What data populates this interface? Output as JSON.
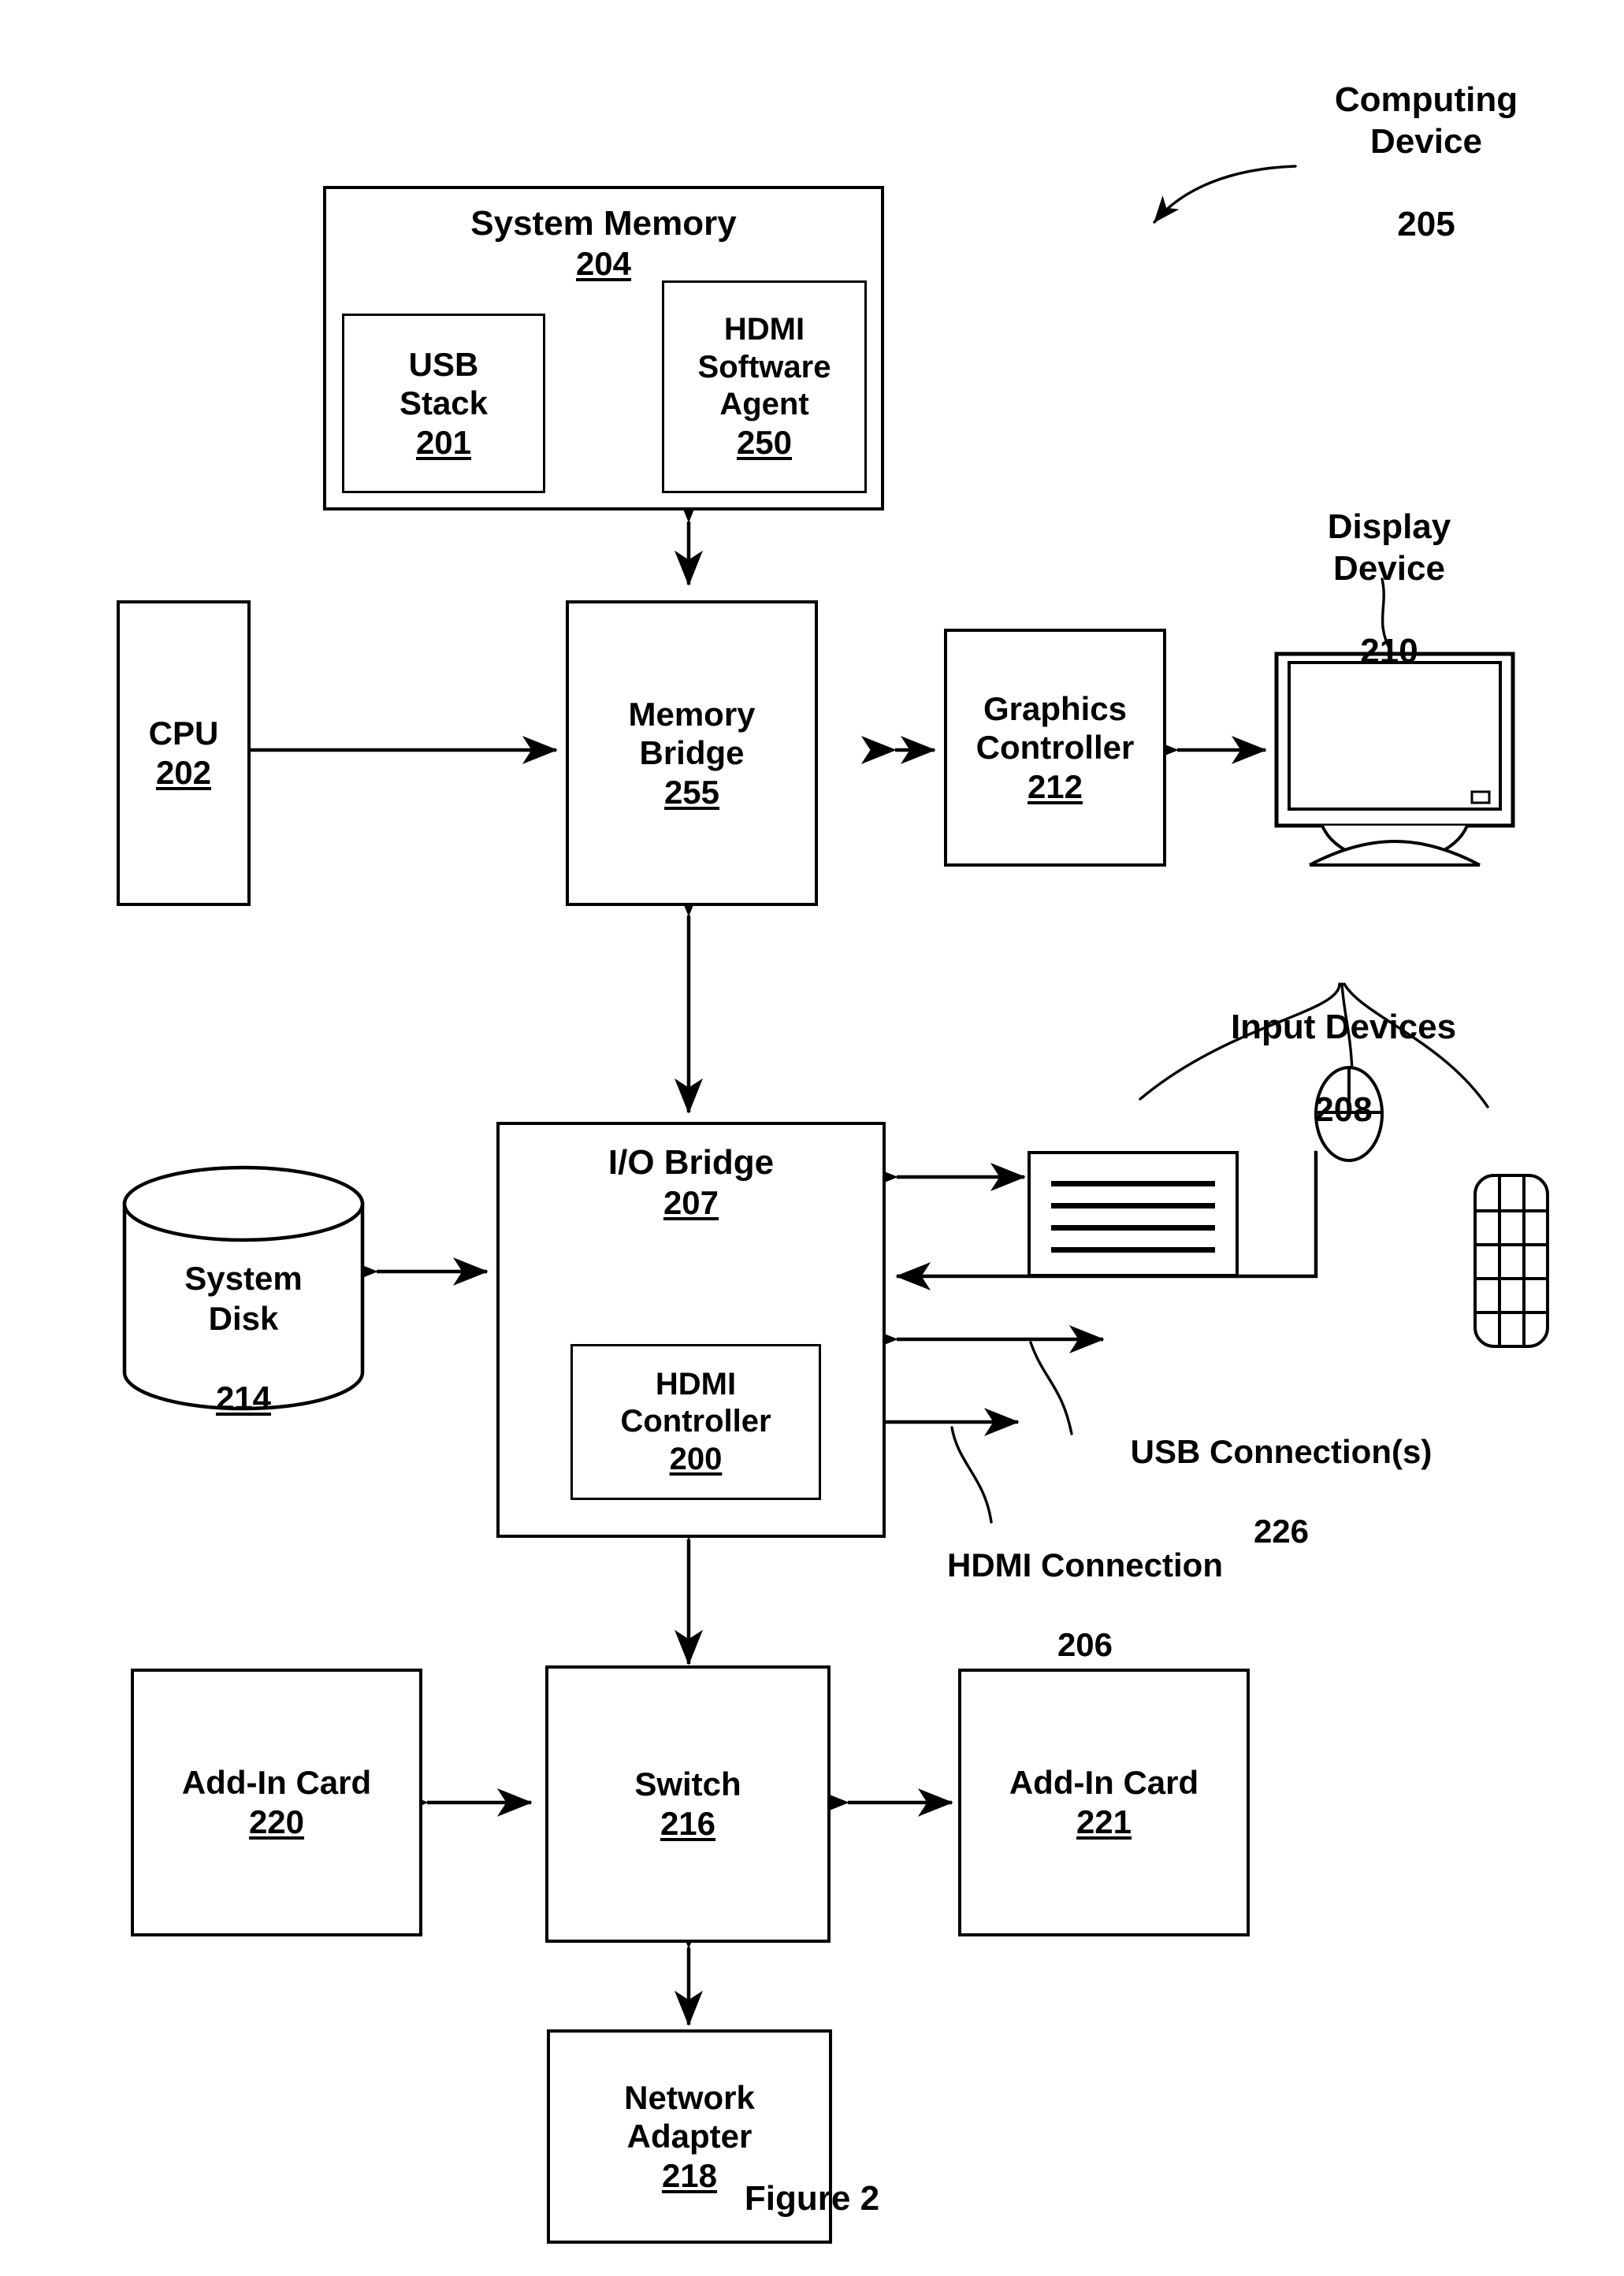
{
  "figure": {
    "caption": "Figure 2"
  },
  "callouts": {
    "computing_device": {
      "label": "Computing\nDevice",
      "ref": "205"
    },
    "display_device": {
      "label": "Display\nDevice",
      "ref": "210"
    },
    "input_devices": {
      "label": "Input Devices",
      "ref": "208"
    },
    "usb_connections": {
      "label": "USB Connection(s)",
      "ref": "226"
    },
    "hdmi_connection": {
      "label": "HDMI Connection",
      "ref": "206"
    }
  },
  "blocks": {
    "system_memory": {
      "label": "System Memory",
      "ref": "204"
    },
    "usb_stack": {
      "label": "USB\nStack",
      "ref": "201"
    },
    "hdmi_software_agent": {
      "label": "HDMI\nSoftware\nAgent",
      "ref": "250"
    },
    "cpu": {
      "label": "CPU",
      "ref": "202"
    },
    "memory_bridge": {
      "label": "Memory\nBridge",
      "ref": "255"
    },
    "graphics_controller": {
      "label": "Graphics\nController",
      "ref": "212"
    },
    "io_bridge": {
      "label": "I/O Bridge",
      "ref": "207"
    },
    "hdmi_controller": {
      "label": "HDMI\nController",
      "ref": "200"
    },
    "system_disk": {
      "label": "System\nDisk",
      "ref": "214"
    },
    "add_in_card_left": {
      "label": "Add-In Card",
      "ref": "220"
    },
    "switch": {
      "label": "Switch",
      "ref": "216"
    },
    "add_in_card_right": {
      "label": "Add-In Card",
      "ref": "221"
    },
    "network_adapter": {
      "label": "Network\nAdapter",
      "ref": "218"
    }
  },
  "icons": {
    "monitor": "display-monitor-icon",
    "mouse": "computer-mouse-icon",
    "keyboard": "keyboard-icon",
    "numpad": "numeric-keypad-icon",
    "disk": "disk-cylinder-icon"
  },
  "colors": {
    "stroke": "#000000",
    "fill": "#ffffff"
  }
}
